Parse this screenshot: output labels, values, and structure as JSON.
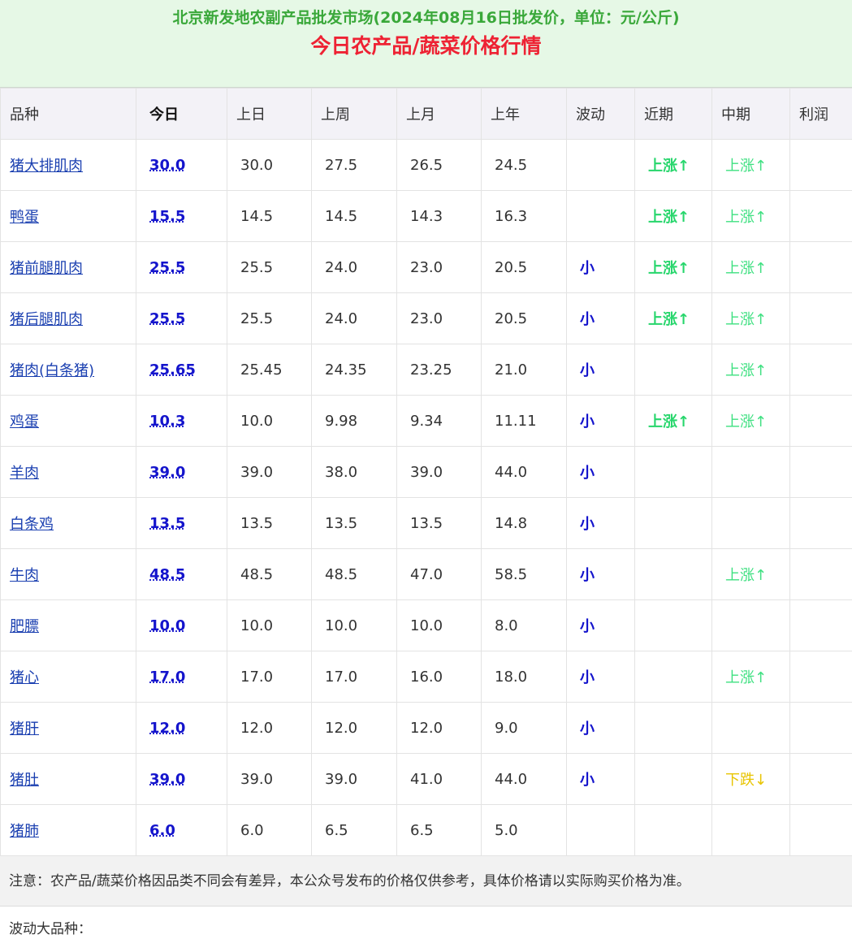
{
  "header": {
    "title": "北京新发地农副产品批发市场(2024年08月16日批发价，单位：元/公斤)",
    "subtitle": "今日农产品/蔬菜价格行情"
  },
  "columns": [
    "品种",
    "今日",
    "上日",
    "上周",
    "上月",
    "上年",
    "波动",
    "近期",
    "中期",
    "利润"
  ],
  "rows": [
    {
      "name": "猪大排肌肉",
      "today": "30.0",
      "prev_day": "30.0",
      "prev_week": "27.5",
      "prev_month": "26.5",
      "prev_year": "24.5",
      "volatility": "",
      "near": "上涨↑",
      "mid": "上涨↑",
      "profit": ""
    },
    {
      "name": "鸭蛋",
      "today": "15.5",
      "prev_day": "14.5",
      "prev_week": "14.5",
      "prev_month": "14.3",
      "prev_year": "16.3",
      "volatility": "",
      "near": "上涨↑",
      "mid": "上涨↑",
      "profit": ""
    },
    {
      "name": "猪前腿肌肉",
      "today": "25.5",
      "prev_day": "25.5",
      "prev_week": "24.0",
      "prev_month": "23.0",
      "prev_year": "20.5",
      "volatility": "小",
      "near": "上涨↑",
      "mid": "上涨↑",
      "profit": ""
    },
    {
      "name": "猪后腿肌肉",
      "today": "25.5",
      "prev_day": "25.5",
      "prev_week": "24.0",
      "prev_month": "23.0",
      "prev_year": "20.5",
      "volatility": "小",
      "near": "上涨↑",
      "mid": "上涨↑",
      "profit": ""
    },
    {
      "name": "猪肉(白条猪)",
      "today": "25.65",
      "prev_day": "25.45",
      "prev_week": "24.35",
      "prev_month": "23.25",
      "prev_year": "21.0",
      "volatility": "小",
      "near": "",
      "mid": "上涨↑",
      "profit": ""
    },
    {
      "name": "鸡蛋",
      "today": "10.3",
      "prev_day": "10.0",
      "prev_week": "9.98",
      "prev_month": "9.34",
      "prev_year": "11.11",
      "volatility": "小",
      "near": "上涨↑",
      "mid": "上涨↑",
      "profit": ""
    },
    {
      "name": "羊肉",
      "today": "39.0",
      "prev_day": "39.0",
      "prev_week": "38.0",
      "prev_month": "39.0",
      "prev_year": "44.0",
      "volatility": "小",
      "near": "",
      "mid": "",
      "profit": ""
    },
    {
      "name": "白条鸡",
      "today": "13.5",
      "prev_day": "13.5",
      "prev_week": "13.5",
      "prev_month": "13.5",
      "prev_year": "14.8",
      "volatility": "小",
      "near": "",
      "mid": "",
      "profit": ""
    },
    {
      "name": "牛肉",
      "today": "48.5",
      "prev_day": "48.5",
      "prev_week": "48.5",
      "prev_month": "47.0",
      "prev_year": "58.5",
      "volatility": "小",
      "near": "",
      "mid": "上涨↑",
      "profit": ""
    },
    {
      "name": "肥膘",
      "today": "10.0",
      "prev_day": "10.0",
      "prev_week": "10.0",
      "prev_month": "10.0",
      "prev_year": "8.0",
      "volatility": "小",
      "near": "",
      "mid": "",
      "profit": ""
    },
    {
      "name": "猪心",
      "today": "17.0",
      "prev_day": "17.0",
      "prev_week": "17.0",
      "prev_month": "16.0",
      "prev_year": "18.0",
      "volatility": "小",
      "near": "",
      "mid": "上涨↑",
      "profit": ""
    },
    {
      "name": "猪肝",
      "today": "12.0",
      "prev_day": "12.0",
      "prev_week": "12.0",
      "prev_month": "12.0",
      "prev_year": "9.0",
      "volatility": "小",
      "near": "",
      "mid": "",
      "profit": ""
    },
    {
      "name": "猪肚",
      "today": "39.0",
      "prev_day": "39.0",
      "prev_week": "39.0",
      "prev_month": "41.0",
      "prev_year": "44.0",
      "volatility": "小",
      "near": "",
      "mid": "下跌↓",
      "profit": ""
    },
    {
      "name": "猪肺",
      "today": "6.0",
      "prev_day": "6.0",
      "prev_week": "6.5",
      "prev_month": "6.5",
      "prev_year": "5.0",
      "volatility": "",
      "near": "",
      "mid": "",
      "profit": ""
    }
  ],
  "note": "注意：农产品/蔬菜价格因品类不同会有差异，本公众号发布的价格仅供参考，具体价格请以实际购买价格为准。",
  "footer": "波动大品种：",
  "colors": {
    "title_green": "#3aa83a",
    "subtitle_red": "#ee2233",
    "link_blue": "#1a3fb0",
    "today_blue": "#1414cc",
    "up_green": "#27d66c",
    "down_yellow": "#e8c400",
    "header_bg": "#e6f8e6"
  }
}
